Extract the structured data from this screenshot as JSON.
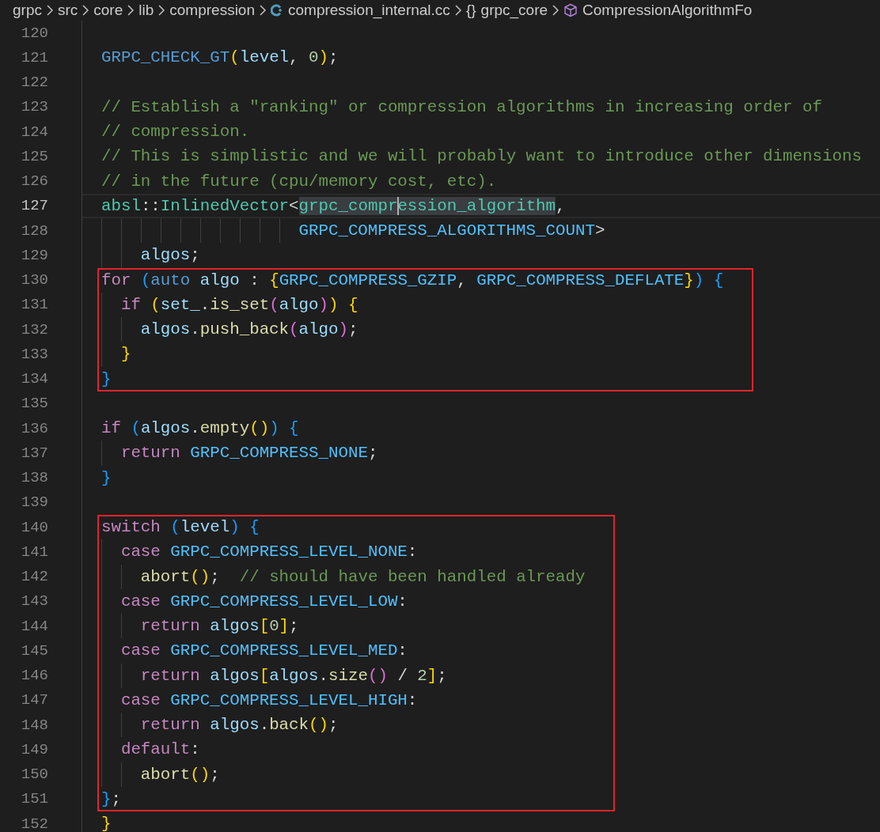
{
  "breadcrumb": [
    {
      "kind": "folder",
      "label": "grpc"
    },
    {
      "kind": "folder",
      "label": "src"
    },
    {
      "kind": "folder",
      "label": "core"
    },
    {
      "kind": "folder",
      "label": "lib"
    },
    {
      "kind": "folder",
      "label": "compression"
    },
    {
      "kind": "cpp-file",
      "label": "compression_internal.cc"
    },
    {
      "kind": "namespace",
      "icon": "{}",
      "label": "grpc_core"
    },
    {
      "kind": "class",
      "label": "CompressionAlgorithmFo"
    }
  ],
  "editor": {
    "sections": [
      {
        "boxed": false,
        "lines": [
          {
            "number": "120",
            "current": false
          },
          {
            "number": "121",
            "current": false,
            "tokens": [
              {
                "kind": "macro",
                "text": "  GRPC_CHECK_GT"
              },
              {
                "kind": "b1",
                "text": "("
              },
              {
                "kind": "var",
                "text": "level"
              },
              {
                "kind": "p",
                "text": ", "
              },
              {
                "kind": "num",
                "text": "0"
              },
              {
                "kind": "b1",
                "text": ")"
              },
              {
                "kind": "p",
                "text": ";"
              }
            ]
          },
          {
            "number": "122",
            "current": false
          },
          {
            "number": "123",
            "current": false,
            "tokens": [
              {
                "kind": "cm",
                "text": "  // Establish a \"ranking\" or compression algorithms in increasing order of"
              }
            ]
          },
          {
            "number": "124",
            "current": false,
            "tokens": [
              {
                "kind": "cm",
                "text": "  // compression."
              }
            ]
          },
          {
            "number": "125",
            "current": false,
            "tokens": [
              {
                "kind": "cm",
                "text": "  // This is simplistic and we will probably want to introduce other dimensions"
              }
            ]
          },
          {
            "number": "126",
            "current": false,
            "tokens": [
              {
                "kind": "cm",
                "text": "  // in the future (cpu/memory cost, etc)."
              }
            ]
          },
          {
            "number": "127",
            "current": true,
            "tokens": [
              {
                "kind": "type",
                "text": "  absl"
              },
              {
                "kind": "p",
                "text": "::"
              },
              {
                "kind": "type",
                "text": "InlinedVector"
              },
              {
                "kind": "p",
                "text": "<"
              },
              {
                "kind": "type",
                "text": "grpc_compr",
                "highlighted": true,
                "caret": false
              },
              {
                "kind": "type",
                "text": "ession_algorithm",
                "highlighted": true,
                "caret": true
              },
              {
                "kind": "p",
                "text": ","
              }
            ]
          },
          {
            "number": "128",
            "current": false,
            "tokens": [
              {
                "kind": "const",
                "text": "                      GRPC_COMPRESS_ALGORITHMS_COUNT"
              },
              {
                "kind": "p",
                "text": ">"
              }
            ]
          },
          {
            "number": "129",
            "current": false,
            "tokens": [
              {
                "kind": "var",
                "text": "      algos"
              },
              {
                "kind": "p",
                "text": ";"
              }
            ]
          }
        ]
      },
      {
        "boxed": true,
        "lines": [
          {
            "number": "130",
            "current": false,
            "tokens": [
              {
                "kind": "kw",
                "text": "  for "
              },
              {
                "kind": "b3",
                "text": "("
              },
              {
                "kind": "st",
                "text": "auto "
              },
              {
                "kind": "var",
                "text": "algo"
              },
              {
                "kind": "p",
                "text": " : "
              },
              {
                "kind": "b1",
                "text": "{"
              },
              {
                "kind": "const",
                "text": "GRPC_COMPRESS_GZIP"
              },
              {
                "kind": "p",
                "text": ", "
              },
              {
                "kind": "const",
                "text": "GRPC_COMPRESS_DEFLATE"
              },
              {
                "kind": "b1",
                "text": "}"
              },
              {
                "kind": "b3",
                "text": ") {"
              }
            ]
          },
          {
            "number": "131",
            "current": false,
            "tokens": [
              {
                "kind": "kw",
                "text": "    if "
              },
              {
                "kind": "b1",
                "text": "("
              },
              {
                "kind": "var",
                "text": "set_"
              },
              {
                "kind": "p",
                "text": "."
              },
              {
                "kind": "fn",
                "text": "is_set"
              },
              {
                "kind": "b2",
                "text": "("
              },
              {
                "kind": "var",
                "text": "algo"
              },
              {
                "kind": "b2",
                "text": ")"
              },
              {
                "kind": "b1",
                "text": ") {"
              }
            ]
          },
          {
            "number": "132",
            "current": false,
            "tokens": [
              {
                "kind": "var",
                "text": "      algos"
              },
              {
                "kind": "p",
                "text": "."
              },
              {
                "kind": "fn",
                "text": "push_back"
              },
              {
                "kind": "b2",
                "text": "("
              },
              {
                "kind": "var",
                "text": "algo"
              },
              {
                "kind": "b2",
                "text": ")"
              },
              {
                "kind": "p",
                "text": ";"
              }
            ]
          },
          {
            "number": "133",
            "current": false,
            "tokens": [
              {
                "kind": "b1",
                "text": "    }"
              }
            ]
          },
          {
            "number": "134",
            "current": false,
            "tokens": [
              {
                "kind": "b3",
                "text": "  }"
              }
            ]
          }
        ]
      },
      {
        "boxed": false,
        "lines": [
          {
            "number": "135",
            "current": false
          },
          {
            "number": "136",
            "current": false,
            "tokens": [
              {
                "kind": "kw",
                "text": "  if "
              },
              {
                "kind": "b3",
                "text": "("
              },
              {
                "kind": "var",
                "text": "algos"
              },
              {
                "kind": "p",
                "text": "."
              },
              {
                "kind": "fn",
                "text": "empty"
              },
              {
                "kind": "b1",
                "text": "()"
              },
              {
                "kind": "b3",
                "text": ") {"
              }
            ]
          },
          {
            "number": "137",
            "current": false,
            "tokens": [
              {
                "kind": "kw",
                "text": "    return "
              },
              {
                "kind": "const",
                "text": "GRPC_COMPRESS_NONE"
              },
              {
                "kind": "p",
                "text": ";"
              }
            ]
          },
          {
            "number": "138",
            "current": false,
            "tokens": [
              {
                "kind": "b3",
                "text": "  }"
              }
            ]
          },
          {
            "number": "139",
            "current": false
          }
        ]
      },
      {
        "boxed": true,
        "lines": [
          {
            "number": "140",
            "current": false,
            "tokens": [
              {
                "kind": "kw",
                "text": "  switch "
              },
              {
                "kind": "b3",
                "text": "("
              },
              {
                "kind": "var",
                "text": "level"
              },
              {
                "kind": "b3",
                "text": ") {"
              }
            ]
          },
          {
            "number": "141",
            "current": false,
            "tokens": [
              {
                "kind": "kw",
                "text": "    case "
              },
              {
                "kind": "const",
                "text": "GRPC_COMPRESS_LEVEL_NONE"
              },
              {
                "kind": "p",
                "text": ":"
              }
            ]
          },
          {
            "number": "142",
            "current": false,
            "tokens": [
              {
                "kind": "fn",
                "text": "      abort"
              },
              {
                "kind": "b1",
                "text": "()"
              },
              {
                "kind": "p",
                "text": ";  "
              },
              {
                "kind": "cm",
                "text": "// should have been handled already"
              }
            ]
          },
          {
            "number": "143",
            "current": false,
            "tokens": [
              {
                "kind": "kw",
                "text": "    case "
              },
              {
                "kind": "const",
                "text": "GRPC_COMPRESS_LEVEL_LOW"
              },
              {
                "kind": "p",
                "text": ":"
              }
            ]
          },
          {
            "number": "144",
            "current": false,
            "tokens": [
              {
                "kind": "kw",
                "text": "      return "
              },
              {
                "kind": "var",
                "text": "algos"
              },
              {
                "kind": "b1",
                "text": "["
              },
              {
                "kind": "num",
                "text": "0"
              },
              {
                "kind": "b1",
                "text": "]"
              },
              {
                "kind": "p",
                "text": ";"
              }
            ]
          },
          {
            "number": "145",
            "current": false,
            "tokens": [
              {
                "kind": "kw",
                "text": "    case "
              },
              {
                "kind": "const",
                "text": "GRPC_COMPRESS_LEVEL_MED"
              },
              {
                "kind": "p",
                "text": ":"
              }
            ]
          },
          {
            "number": "146",
            "current": false,
            "tokens": [
              {
                "kind": "kw",
                "text": "      return "
              },
              {
                "kind": "var",
                "text": "algos"
              },
              {
                "kind": "b1",
                "text": "["
              },
              {
                "kind": "var",
                "text": "algos"
              },
              {
                "kind": "p",
                "text": "."
              },
              {
                "kind": "fn",
                "text": "size"
              },
              {
                "kind": "b2",
                "text": "()"
              },
              {
                "kind": "p",
                "text": " / "
              },
              {
                "kind": "num",
                "text": "2"
              },
              {
                "kind": "b1",
                "text": "]"
              },
              {
                "kind": "p",
                "text": ";"
              }
            ]
          },
          {
            "number": "147",
            "current": false,
            "tokens": [
              {
                "kind": "kw",
                "text": "    case "
              },
              {
                "kind": "const",
                "text": "GRPC_COMPRESS_LEVEL_HIGH"
              },
              {
                "kind": "p",
                "text": ":"
              }
            ]
          },
          {
            "number": "148",
            "current": false,
            "tokens": [
              {
                "kind": "kw",
                "text": "      return "
              },
              {
                "kind": "var",
                "text": "algos"
              },
              {
                "kind": "p",
                "text": "."
              },
              {
                "kind": "fn",
                "text": "back"
              },
              {
                "kind": "b1",
                "text": "()"
              },
              {
                "kind": "p",
                "text": ";"
              }
            ]
          },
          {
            "number": "149",
            "current": false,
            "tokens": [
              {
                "kind": "kw",
                "text": "    default"
              },
              {
                "kind": "p",
                "text": ":"
              }
            ]
          },
          {
            "number": "150",
            "current": false,
            "tokens": [
              {
                "kind": "fn",
                "text": "      abort"
              },
              {
                "kind": "b1",
                "text": "()"
              },
              {
                "kind": "p",
                "text": ";"
              }
            ]
          },
          {
            "number": "151",
            "current": false,
            "tokens": [
              {
                "kind": "b3",
                "text": "  }"
              },
              {
                "kind": "p",
                "text": ";"
              }
            ]
          }
        ]
      },
      {
        "boxed": false,
        "lines": [
          {
            "number": "152",
            "current": false,
            "tokens": [
              {
                "kind": "b1",
                "text": "}"
              }
            ]
          }
        ]
      }
    ]
  }
}
